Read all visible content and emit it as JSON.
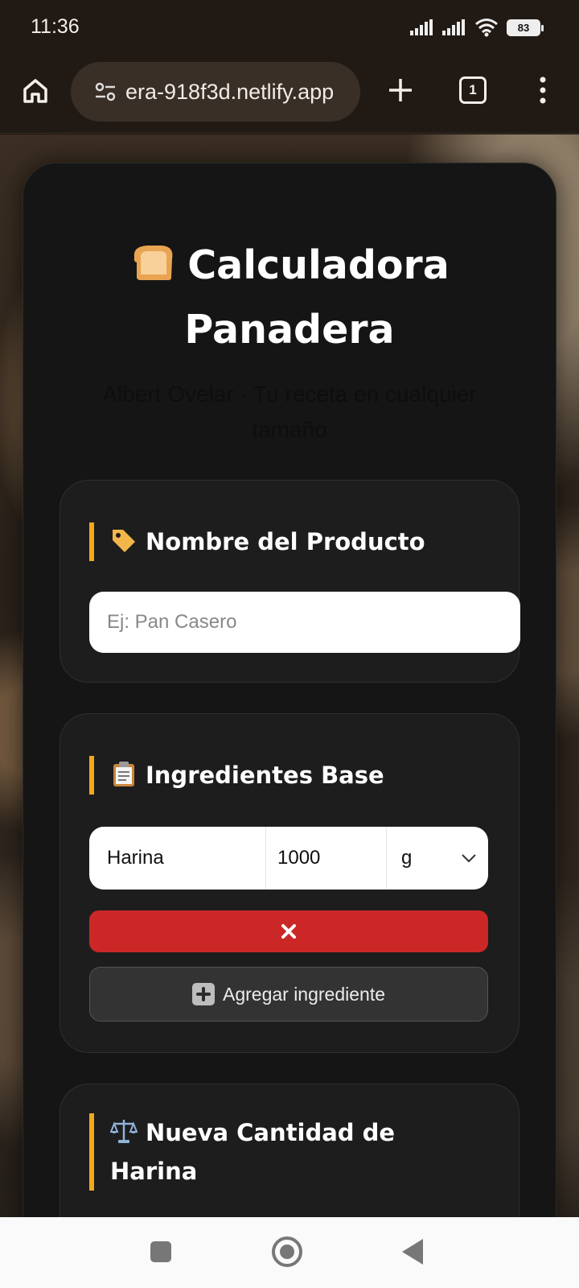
{
  "status_bar": {
    "time": "11:36",
    "battery": "83"
  },
  "browser": {
    "url": "era-918f3d.netlify.app",
    "tab_count": "1"
  },
  "header": {
    "title_line1": "Calculadora",
    "title_line2": "Panadera",
    "subtitle": "Albert Ovelar · Tu receta en cualquier tamaño"
  },
  "product_section": {
    "title": "Nombre del Producto",
    "input_placeholder": "Ej: Pan Casero"
  },
  "ingredients_section": {
    "title": "Ingredientes Base",
    "rows": [
      {
        "name": "Harina",
        "quantity": "1000",
        "unit": "g"
      }
    ],
    "delete_label": "✖",
    "add_label": "Agregar ingrediente"
  },
  "quantity_section": {
    "title": "Nueva Cantidad de Harina"
  },
  "colors": {
    "accent": "#f0a81c",
    "danger": "#cc2727",
    "card": "#1d1d1d"
  }
}
